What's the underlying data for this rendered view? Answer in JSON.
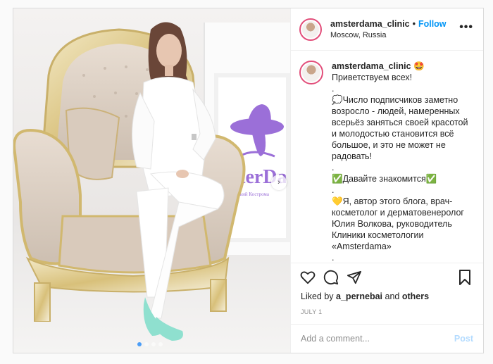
{
  "post": {
    "username": "amsterdama_clinic",
    "follow_label": "Follow",
    "location": "Moscow, Russia",
    "more_icon": "more-horizontal-icon",
    "photo": {
      "panel_logo_text": "AsterDa",
      "panel_subtitle": "Кремлёвский Кострома",
      "slide_count": 4,
      "active_slide": 1
    },
    "caption": {
      "username": "amsterdama_clinic",
      "text": " 🤩Приветствуем всех!\n.\n💭Число подписчиков заметно возросло - людей, намеренных всерьёз заняться своей красотой и молодостью становится всё большое, и это не может не радовать!\n.\n✅Давайте знакомится✅\n.\n💛Я, автор этого блога, врач-косметолог и дерматовенеролог Юлия Волкова, руководитель Клиники косметологии «Amsterdama»\n.\n📌Помимо задач руководящей должности , я ещё и принимаю пациентов: консультирую на"
    },
    "actions": {
      "like_icon": "heart-icon",
      "comment_icon": "comment-icon",
      "share_icon": "send-icon",
      "save_icon": "bookmark-icon"
    },
    "likes": {
      "prefix": "Liked by ",
      "user": "a_pernebai",
      "middle": " and ",
      "others": "others"
    },
    "date": "JULY 1",
    "add_comment": {
      "placeholder": "Add a comment...",
      "post_label": "Post"
    }
  },
  "colors": {
    "accent": "#0095f6",
    "post_disabled": "#b3dbff",
    "avatar_ring": "#e24e7a",
    "muted": "#8e8e8e",
    "brand_purple": "#9b6fd8"
  }
}
